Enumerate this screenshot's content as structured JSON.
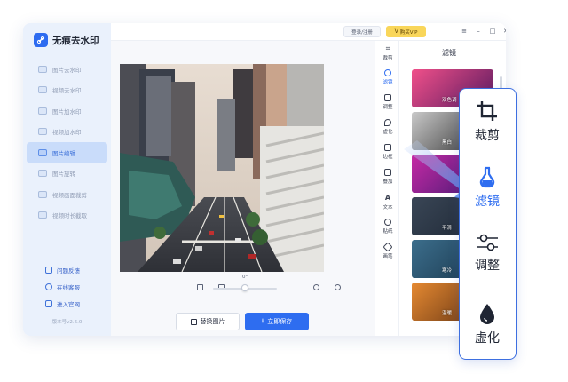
{
  "app": {
    "title": "无痕去水印",
    "logo_icon": "link-icon",
    "version": "版本号v2.6.0"
  },
  "sidebar": {
    "items": [
      {
        "label": "图片去水印",
        "icon": "image-icon",
        "active": false
      },
      {
        "label": "视频去水印",
        "icon": "video-icon",
        "active": false
      },
      {
        "label": "图片加水印",
        "icon": "image-watermark-icon",
        "active": false
      },
      {
        "label": "视频加水印",
        "icon": "video-watermark-icon",
        "active": false
      },
      {
        "label": "图片编辑",
        "icon": "image-edit-icon",
        "active": true
      },
      {
        "label": "图片旋转",
        "icon": "rotate-icon",
        "active": false
      },
      {
        "label": "视频画面裁剪",
        "icon": "video-crop-icon",
        "active": false
      },
      {
        "label": "视频时长截取",
        "icon": "video-trim-icon",
        "active": false
      }
    ],
    "links": [
      {
        "label": "问题反馈",
        "icon": "feedback-icon"
      },
      {
        "label": "在线客服",
        "icon": "support-icon"
      },
      {
        "label": "进入官网",
        "icon": "website-icon"
      }
    ]
  },
  "topbar": {
    "login_label": "登录/注册",
    "vip_label": "购买VIP",
    "menu_icon": "≡",
    "minimize_icon": "–",
    "maximize_icon": "□",
    "close_icon": "✕"
  },
  "editor": {
    "rotation_value": "0°",
    "rotation_level": 0.5,
    "replace_label": "替换图片",
    "save_label": "立即保存"
  },
  "tools": [
    {
      "label": "裁剪",
      "icon": "crop-icon",
      "active": false
    },
    {
      "label": "滤镜",
      "icon": "filter-icon",
      "active": true
    },
    {
      "label": "调整",
      "icon": "adjust-icon",
      "active": false
    },
    {
      "label": "虚化",
      "icon": "blur-icon",
      "active": false
    },
    {
      "label": "边框",
      "icon": "border-icon",
      "active": false
    },
    {
      "label": "叠加",
      "icon": "overlay-icon",
      "active": false
    },
    {
      "label": "文本",
      "icon": "text-icon",
      "active": false
    },
    {
      "label": "贴纸",
      "icon": "sticker-icon",
      "active": false
    },
    {
      "label": "画笔",
      "icon": "brush-icon",
      "active": false
    }
  ],
  "filters": {
    "title": "滤镜",
    "items": [
      {
        "label": "双色调",
        "colors": [
          "#f0508a",
          "#5a1a5f"
        ]
      },
      {
        "label": "黑白",
        "colors": [
          "#c9c9c9",
          "#2a2a2a"
        ]
      },
      {
        "label": "",
        "colors": [
          "#c62aa5",
          "#3b186f"
        ]
      },
      {
        "label": "平滑",
        "colors": [
          "#3a4656",
          "#1b2532"
        ]
      },
      {
        "label": "寒冷",
        "colors": [
          "#3c6e8c",
          "#173348"
        ]
      },
      {
        "label": "温暖",
        "colors": [
          "#e68a32",
          "#5a2d10"
        ]
      }
    ]
  },
  "callout": {
    "items": [
      {
        "label": "",
        "icon": "crop-icon",
        "active": false
      },
      {
        "label": "裁剪",
        "icon": "crop-icon",
        "active": false
      },
      {
        "label": "滤镜",
        "icon": "filter-icon",
        "active": true
      },
      {
        "label": "调整",
        "icon": "adjust-icon",
        "active": false
      },
      {
        "label": "虚化",
        "icon": "blur-icon",
        "active": false
      }
    ]
  },
  "colors": {
    "accent": "#2e6df0",
    "vip": "#f9d65a",
    "sidebar_bg": "#eaf1fc"
  }
}
